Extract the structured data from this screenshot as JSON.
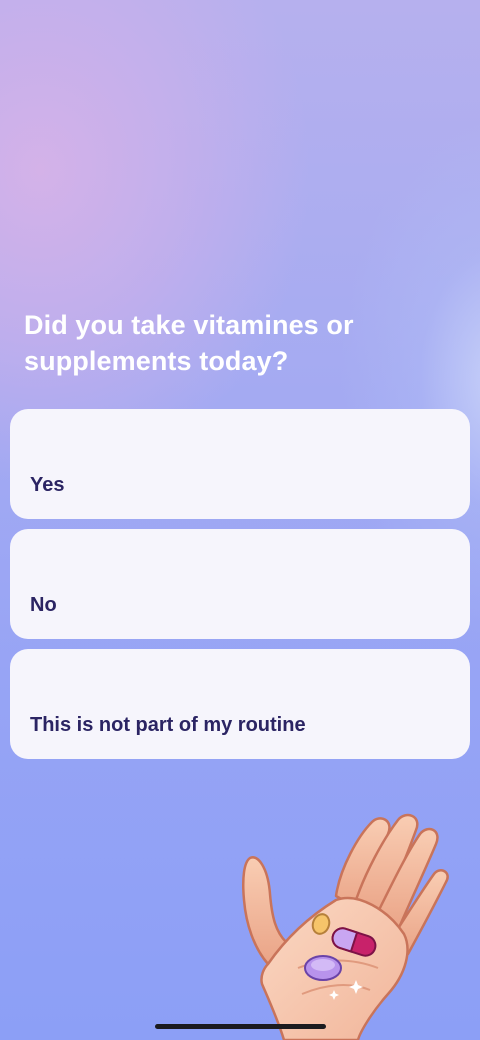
{
  "question": "Did you take vitamines or supplements today?",
  "options": [
    {
      "label": "Yes"
    },
    {
      "label": "No"
    },
    {
      "label": "This is not part of my routine"
    }
  ],
  "illustration": "hand-holding-pills-icon",
  "colors": {
    "card_background": "#f6f5fc",
    "option_text": "#2b2463",
    "question_text": "#ffffff",
    "background_top": "#b6b0ee",
    "background_bottom": "#8c9ff6"
  }
}
